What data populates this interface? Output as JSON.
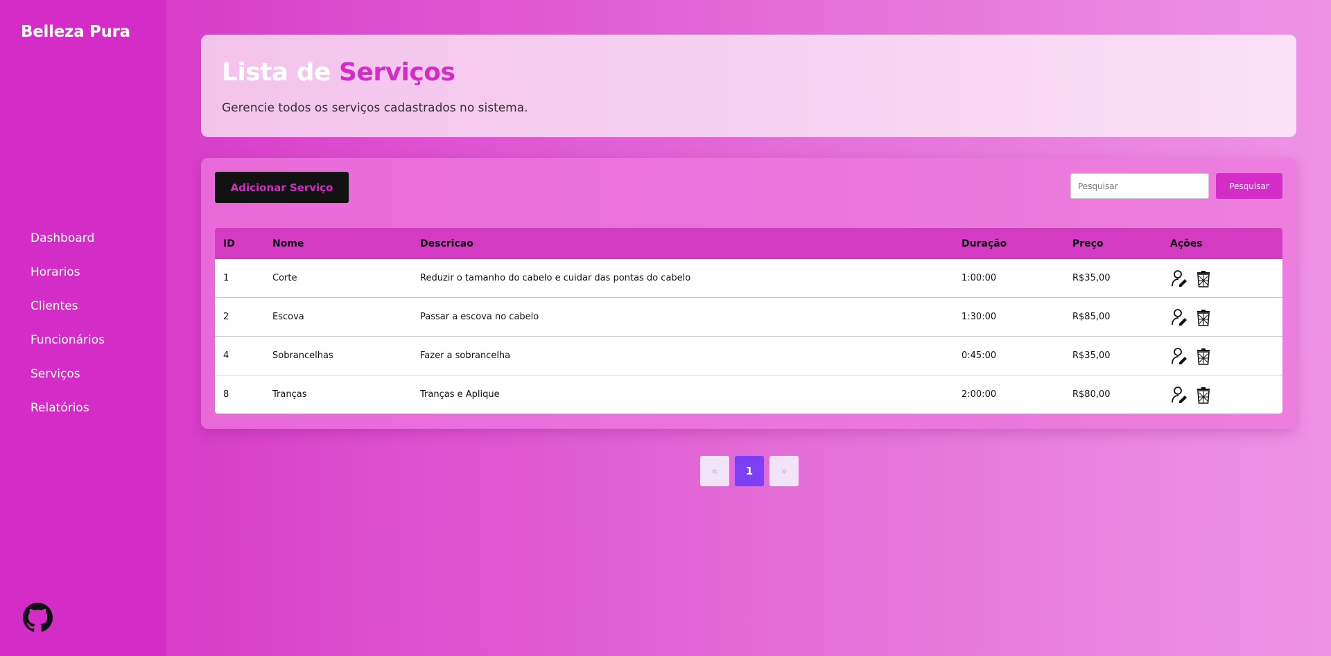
{
  "sidebar": {
    "brand": "Belleza Pura",
    "items": [
      {
        "label": "Dashboard"
      },
      {
        "label": "Horarios"
      },
      {
        "label": "Clientes"
      },
      {
        "label": "Funcionários"
      },
      {
        "label": "Serviços"
      },
      {
        "label": "Relatórios"
      }
    ],
    "footer_icon": "github-icon"
  },
  "header": {
    "title_part1": "Lista de ",
    "title_part2": "Serviços",
    "subtitle": "Gerencie todos os serviços cadastrados no sistema."
  },
  "toolbar": {
    "add_label": "Adicionar Serviço",
    "search_placeholder": "Pesquisar",
    "search_value": "",
    "search_label": "Pesquisar"
  },
  "table": {
    "columns": [
      "ID",
      "Nome",
      "Descricao",
      "Duração",
      "Preço",
      "Ações"
    ],
    "rows": [
      {
        "id": "1",
        "nome": "Corte",
        "descricao": "Reduzir o tamanho do cabelo e cuidar das pontas do cabelo",
        "duracao": "1:00:00",
        "preco": "R$35,00"
      },
      {
        "id": "2",
        "nome": "Escova",
        "descricao": "Passar a escova no cabelo",
        "duracao": "1:30:00",
        "preco": "R$85,00"
      },
      {
        "id": "4",
        "nome": "Sobrancelhas",
        "descricao": "Fazer a sobrancelha",
        "duracao": "0:45:00",
        "preco": "R$35,00"
      },
      {
        "id": "8",
        "nome": "Tranças",
        "descricao": "Tranças e Aplique",
        "duracao": "2:00:00",
        "preco": "R$80,00"
      }
    ],
    "action_icons": [
      "edit-user-icon",
      "trash-icon"
    ]
  },
  "pagination": {
    "prev": "«",
    "current": "1",
    "next": "»"
  },
  "colors": {
    "accent": "#d42cc6",
    "page_active": "#7d3ff5",
    "button_dark": "#111111"
  }
}
